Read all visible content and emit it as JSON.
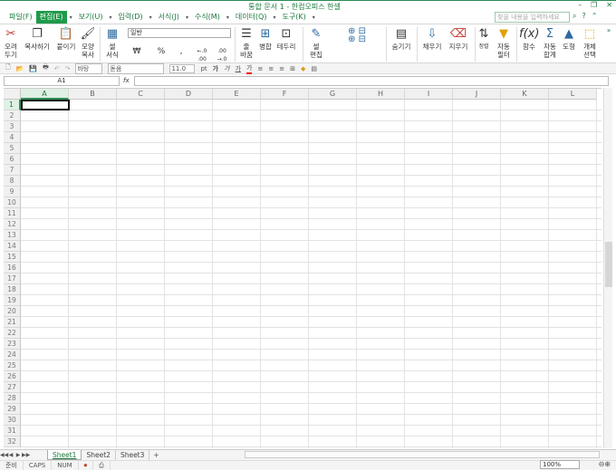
{
  "title": "통합 문서 1 - 한컴오피스 한셀",
  "window_buttons": [
    "–",
    "❐",
    "✕"
  ],
  "menu": [
    {
      "label": "파일(F)"
    },
    {
      "label": "편집(E)",
      "active": true
    },
    {
      "label": "보기(U)"
    },
    {
      "label": "입력(D)"
    },
    {
      "label": "서식(J)"
    },
    {
      "label": "수식(M)"
    },
    {
      "label": "데이터(Q)"
    },
    {
      "label": "도구(K)"
    }
  ],
  "search_placeholder": "찾을 내용을 입력하세요",
  "ribbon": {
    "cut": "오려\n두기",
    "copy": "복사하기",
    "paste": "붙이기",
    "format_painter": "모양\n복사",
    "cell_format": "셀\n서식",
    "number_format": "일반",
    "currency": "₩",
    "percent": "%",
    "comma": ",",
    "dec_inc": "←.0 .00",
    "dec_dec": ".00 →.0",
    "wrap": "줄\n바꿈",
    "merge": "병합",
    "border": "테두리",
    "cell_edit": "셀\n편집",
    "hide": "숨기기",
    "fill": "채우기",
    "clear": "지우기",
    "sort": "정렬",
    "autofilter": "자동\n필터",
    "function": "함수",
    "autosum": "자동\n합계",
    "shape": "도형",
    "select_obj": "개체\n선택"
  },
  "toolbar2": {
    "style": "바탕",
    "font": "돋움",
    "size": "11.0",
    "unit": "pt",
    "bold": "가",
    "italic": "가",
    "underline": "가",
    "fontcolor": "가"
  },
  "name_box": "A1",
  "fx_label": "fx",
  "columns": [
    "A",
    "B",
    "C",
    "D",
    "E",
    "F",
    "G",
    "H",
    "I",
    "J",
    "K",
    "L"
  ],
  "rows": [
    "1",
    "2",
    "3",
    "4",
    "5",
    "6",
    "7",
    "8",
    "9",
    "10",
    "11",
    "12",
    "13",
    "14",
    "15",
    "16",
    "17",
    "18",
    "19",
    "20",
    "21",
    "22",
    "23",
    "24",
    "25",
    "26",
    "27",
    "28",
    "29",
    "30",
    "31",
    "32"
  ],
  "sheets": [
    "Sheet1",
    "Sheet2",
    "Sheet3"
  ],
  "add_sheet": "+",
  "status": {
    "ready": "준비",
    "caps": "CAPS",
    "num": "NUM",
    "zoom": "100%"
  },
  "colors": {
    "accent": "#1f9a4a",
    "text_green": "#1a7a3c"
  }
}
